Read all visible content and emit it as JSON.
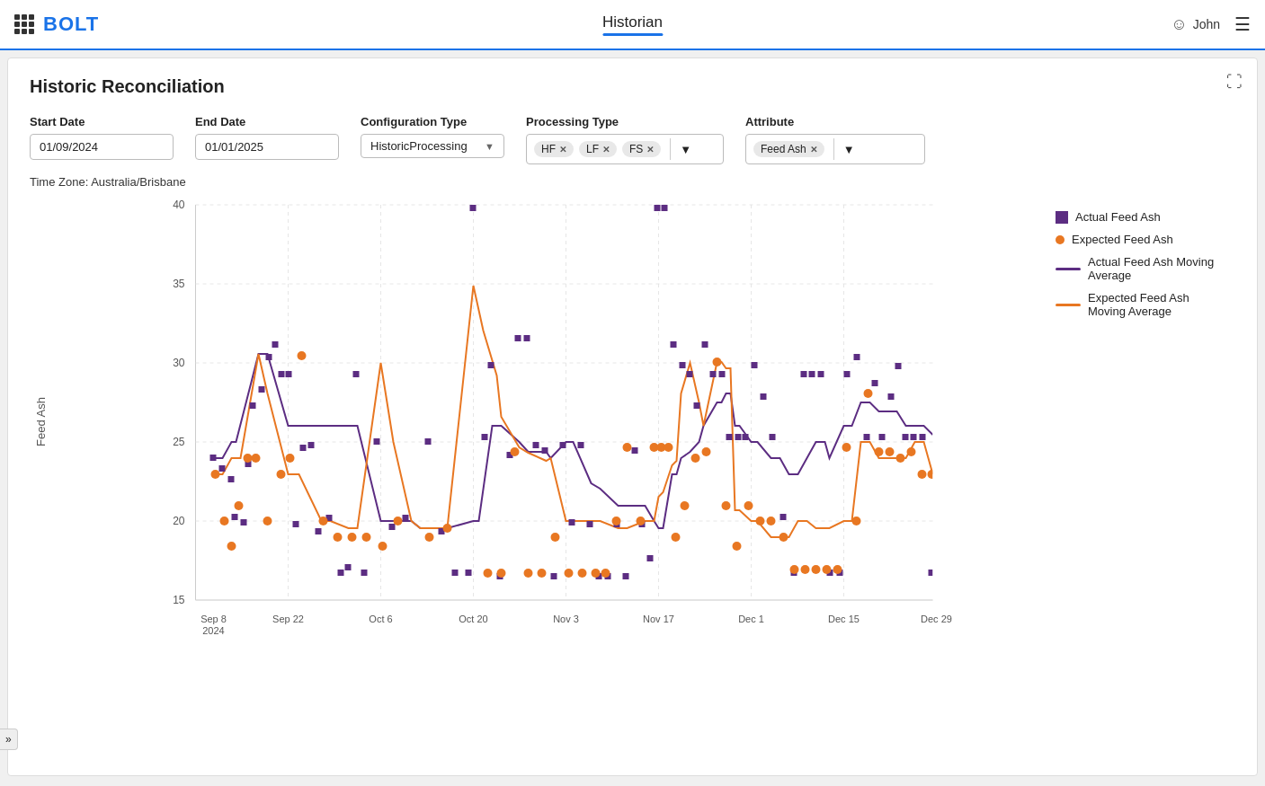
{
  "topnav": {
    "app_name": "BOLT",
    "nav_title": "Historian",
    "user_name": "John"
  },
  "page": {
    "title": "Historic Reconciliation"
  },
  "filters": {
    "start_date_label": "Start Date",
    "start_date_value": "01/09/2024",
    "end_date_label": "End Date",
    "end_date_value": "01/01/2025",
    "config_type_label": "Configuration Type",
    "config_type_value": "HistoricProcessing",
    "processing_type_label": "Processing Type",
    "processing_tags": [
      "HF",
      "LF",
      "FS"
    ],
    "attribute_label": "Attribute",
    "attribute_tag": "Feed Ash"
  },
  "timezone": {
    "label": "Time Zone: Australia/Brisbane"
  },
  "chart": {
    "y_label": "Feed Ash",
    "x_ticks": [
      "Sep 8\n2024",
      "Sep 22",
      "Oct 6",
      "Oct 20",
      "Nov 3",
      "Nov 17",
      "Dec 1",
      "Dec 15",
      "Dec 29"
    ],
    "y_ticks": [
      15,
      20,
      25,
      30,
      35,
      40
    ],
    "colors": {
      "actual_scatter": "#5c2d82",
      "expected_scatter": "#e87722",
      "actual_line": "#5c2d82",
      "expected_line": "#e87722"
    }
  },
  "legend": {
    "items": [
      {
        "label": "Actual Feed Ash",
        "type": "square",
        "color": "#5c2d82"
      },
      {
        "label": "Expected Feed Ash",
        "type": "circle",
        "color": "#e87722"
      },
      {
        "label": "Actual Feed Ash Moving Average",
        "type": "line",
        "color": "#5c2d82"
      },
      {
        "label": "Expected Feed Ash Moving Average",
        "type": "line",
        "color": "#e87722"
      }
    ]
  }
}
